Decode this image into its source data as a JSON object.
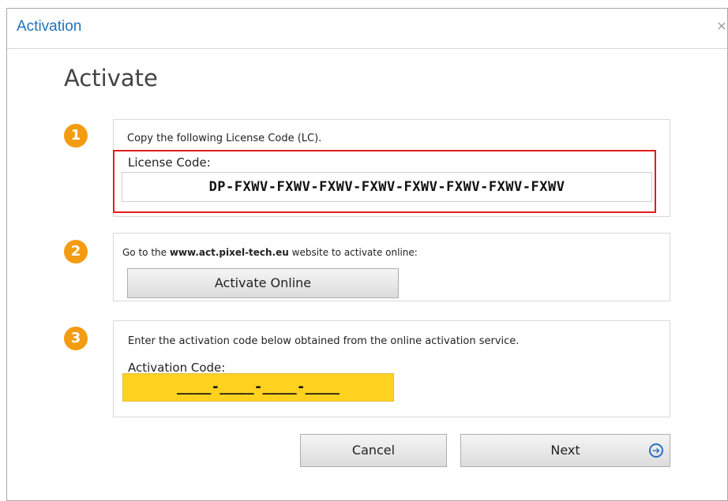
{
  "window": {
    "title": "Activation",
    "close_glyph": "×"
  },
  "heading": "Activate",
  "steps": [
    {
      "number": "1",
      "instruction": "Copy the following License Code (LC).",
      "field_label": "License Code:",
      "field_value": "DP-FXWV-FXWV-FXWV-FXWV-FXWV-FXWV-FXWV-FXWV"
    },
    {
      "number": "2",
      "instruction_prefix": "Go to the ",
      "instruction_link": "www.act.pixel-tech.eu",
      "instruction_suffix": " website to activate online:",
      "button_label": "Activate Online"
    },
    {
      "number": "3",
      "instruction": "Enter the activation code below obtained from the online activation service.",
      "field_label": "Activation Code:",
      "field_value": "____-____-____-____"
    }
  ],
  "footer": {
    "cancel_label": "Cancel",
    "next_label": "Next",
    "next_icon": "arrow-circle-right-icon"
  },
  "colors": {
    "title": "#1e73be",
    "step_badge": "#f39c12",
    "highlight": "#e41c1c",
    "activation_field": "#ffd21f"
  }
}
